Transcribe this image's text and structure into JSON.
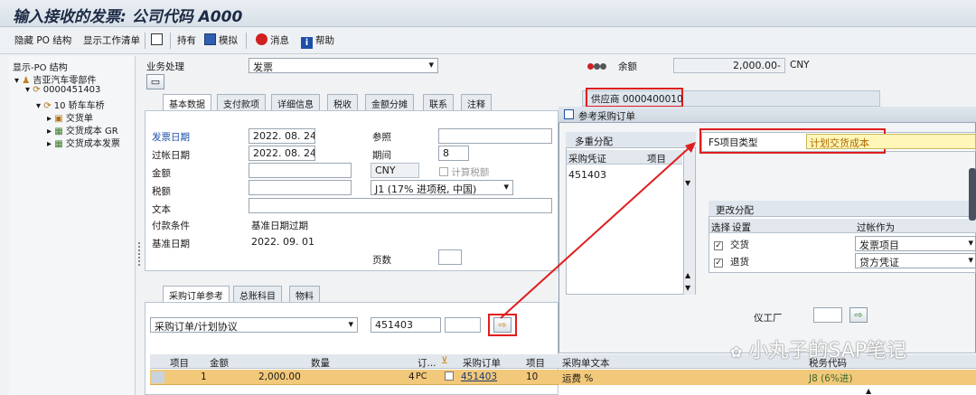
{
  "title": "输入接收的发票: 公司代码 A000",
  "toolbar": {
    "hide_po": "隐藏 PO 结构",
    "show_worklist": "显示工作清单",
    "hold": "持有",
    "simulate": "模拟",
    "messages": "消息",
    "help": "帮助"
  },
  "tree": {
    "header": "显示-PO 结构",
    "vendor": "吉亚汽车零部件",
    "po": "0000451403",
    "item": "10 轿车车桥",
    "children": [
      "交货单",
      "交货成本 GR",
      "交货成本发票"
    ]
  },
  "header": {
    "transaction_label": "业务处理",
    "transaction_value": "发票",
    "balance_label": "余额",
    "balance_value": "2,000.00-",
    "balance_currency": "CNY",
    "vendor_label": "供应商 0000400010"
  },
  "tabs": [
    "基本数据",
    "支付款项",
    "详细信息",
    "税收",
    "金额分摊",
    "联系",
    "注释"
  ],
  "basic": {
    "invoice_date_label": "发票日期",
    "invoice_date": "2022. 08. 24",
    "posting_date_label": "过帐日期",
    "posting_date": "2022. 08. 24",
    "amount_label": "金额",
    "tax_label": "税额",
    "text_label": "文本",
    "payment_terms_label": "付款条件",
    "payment_terms_value": "基准日期过期",
    "baseline_label": "基准日期",
    "baseline_value": "2022. 09. 01",
    "reference_label": "参照",
    "period_label": "期间",
    "period_value": "8",
    "currency": "CNY",
    "calc_tax_label": "计算税额",
    "tax_code": "J1 (17% 进项税, 中国)",
    "pages_label": "页数"
  },
  "po_tabs": [
    "采购订单参考",
    "总账科目",
    "物料"
  ],
  "po_ref": {
    "doc_type": "采购订单/计划协议",
    "po_number": "451403"
  },
  "grid": {
    "headers": [
      "项目",
      "金额",
      "数量",
      "订...",
      "采购订单",
      "项目",
      "采购单文本",
      "税务代码"
    ],
    "row": {
      "item": "1",
      "amount": "2,000.00",
      "qty": "4",
      "unit": "PC",
      "po": "451403",
      "po_item": "10",
      "text": "运费 %",
      "tax": "J8 (6%进)"
    }
  },
  "popup": {
    "title": "参考采购订单",
    "multi_assign": "多重分配",
    "col_po": "采购凭证",
    "col_item": "项目",
    "po_value": "451403",
    "fs_label": "FS项目类型",
    "fs_value": "计划交货成本",
    "change_assign": "更改分配",
    "col_select": "选择",
    "col_setting": "设置",
    "col_posting": "过帐作为",
    "rows": [
      {
        "setting": "交货",
        "posting": "发票项目"
      },
      {
        "setting": "退货",
        "posting": "贷方凭证"
      }
    ],
    "plant_label": "仪工厂"
  },
  "watermark": "小丸子的SAP笔记",
  "colors": {
    "accent_red": "#e01e1e",
    "highlight_row": "#f2c87a",
    "fs_field": "#fff6b8"
  }
}
